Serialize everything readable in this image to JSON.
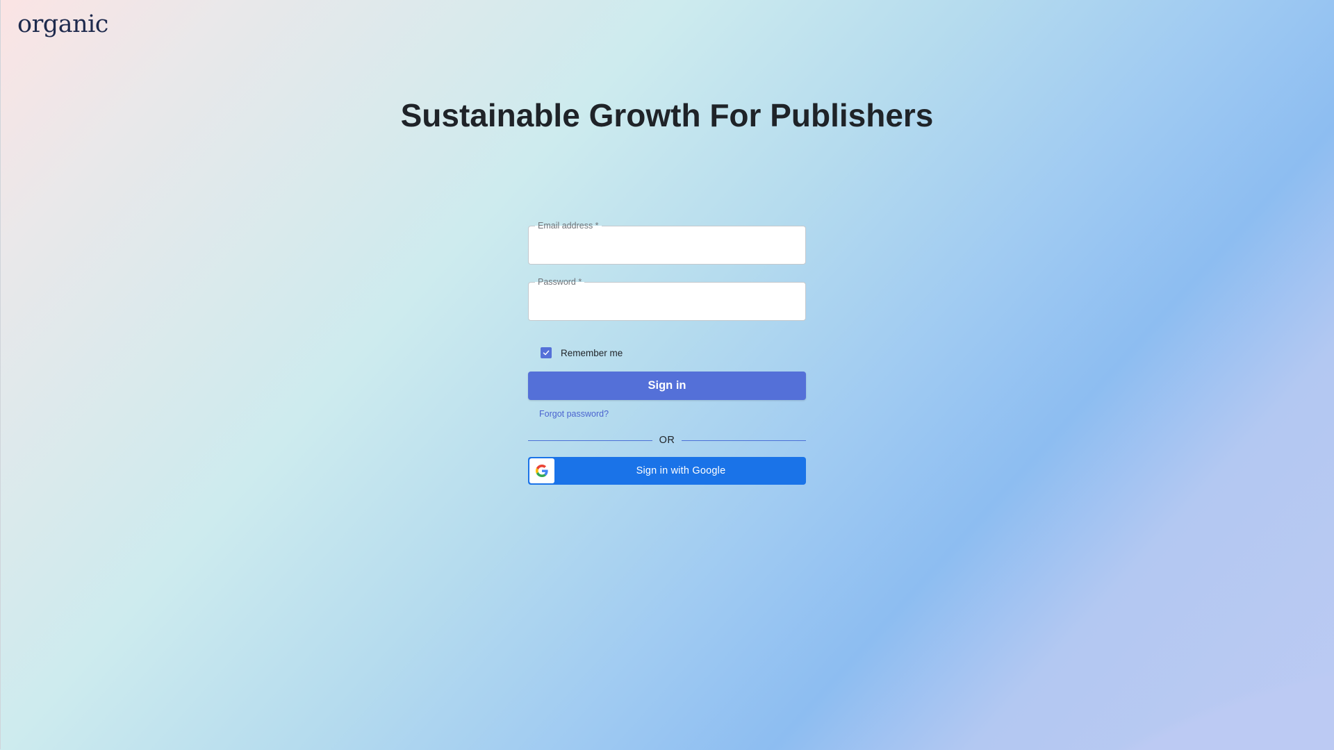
{
  "brand": {
    "logo_text": "organic"
  },
  "hero": {
    "headline": "Sustainable Growth For Publishers"
  },
  "login_form": {
    "email": {
      "label": "Email address *",
      "value": ""
    },
    "password": {
      "label": "Password *",
      "value": ""
    },
    "remember_me": {
      "label": "Remember me",
      "checked": true
    },
    "sign_in_label": "Sign in",
    "forgot_password_label": "Forgot password?",
    "divider_label": "OR",
    "google_sign_in_label": "Sign in with Google"
  },
  "colors": {
    "primary": "#5470d8",
    "google_blue": "#1a73e8",
    "link": "#4a63cf",
    "text": "#1f2328"
  },
  "icons": {
    "checkbox": "check-icon",
    "google": "google-g-icon"
  }
}
